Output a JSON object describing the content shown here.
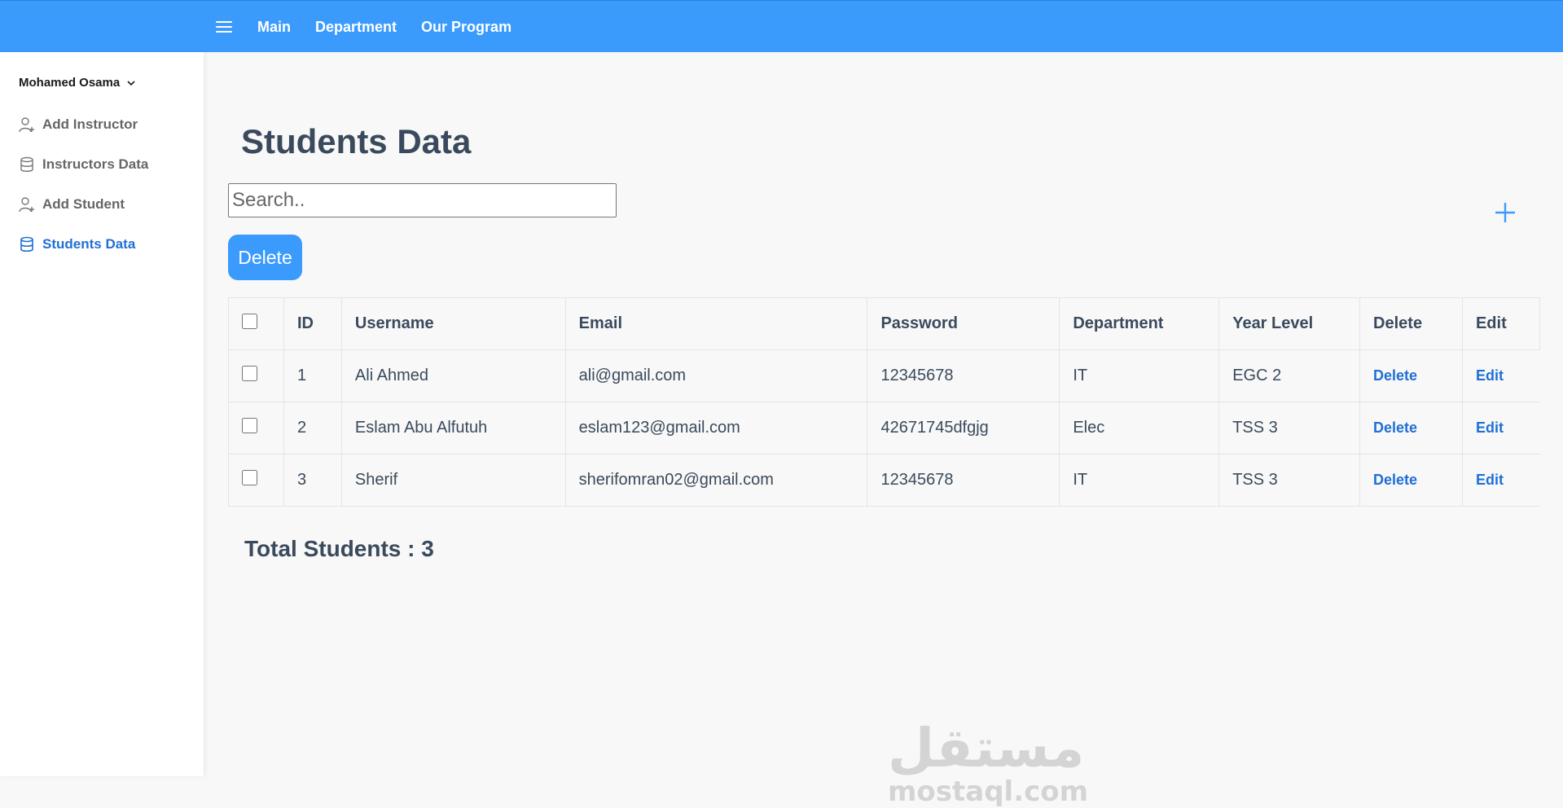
{
  "topbar": {
    "menu_icon": "hamburger-icon",
    "nav": [
      {
        "label": "Main"
      },
      {
        "label": "Department"
      },
      {
        "label": "Our Program"
      }
    ],
    "color": "#3a9bfd"
  },
  "sidebar": {
    "user_name": "Mohamed Osama",
    "items": [
      {
        "label": "Add Instructor",
        "icon": "user-plus-icon",
        "active": false
      },
      {
        "label": "Instructors Data",
        "icon": "database-icon",
        "active": false
      },
      {
        "label": "Add Student",
        "icon": "user-plus-icon",
        "active": false
      },
      {
        "label": "Students Data",
        "icon": "database-icon",
        "active": true
      }
    ]
  },
  "main": {
    "title": "Students Data",
    "search_placeholder": "Search..",
    "add_icon": "plus-icon",
    "delete_button": "Delete",
    "table": {
      "columns": [
        "ID",
        "Username",
        "Email",
        "Password",
        "Department",
        "Year Level",
        "Delete",
        "Edit"
      ],
      "rows": [
        {
          "id": "1",
          "username": "Ali Ahmed",
          "email": "ali@gmail.com",
          "password": "12345678",
          "department": "IT",
          "year": "EGC 2",
          "delete": "Delete",
          "edit": "Edit"
        },
        {
          "id": "2",
          "username": "Eslam Abu Alfutuh",
          "email": "eslam123@gmail.com",
          "password": "42671745dfgjg",
          "department": "Elec",
          "year": "TSS 3",
          "delete": "Delete",
          "edit": "Edit"
        },
        {
          "id": "3",
          "username": "Sherif",
          "email": "sherifomran02@gmail.com",
          "password": "12345678",
          "department": "IT",
          "year": "TSS 3",
          "delete": "Delete",
          "edit": "Edit"
        }
      ]
    },
    "total_label": "Total Students : 3"
  },
  "watermark": {
    "arabic": "مستقل",
    "latin": "mostaql.com"
  }
}
